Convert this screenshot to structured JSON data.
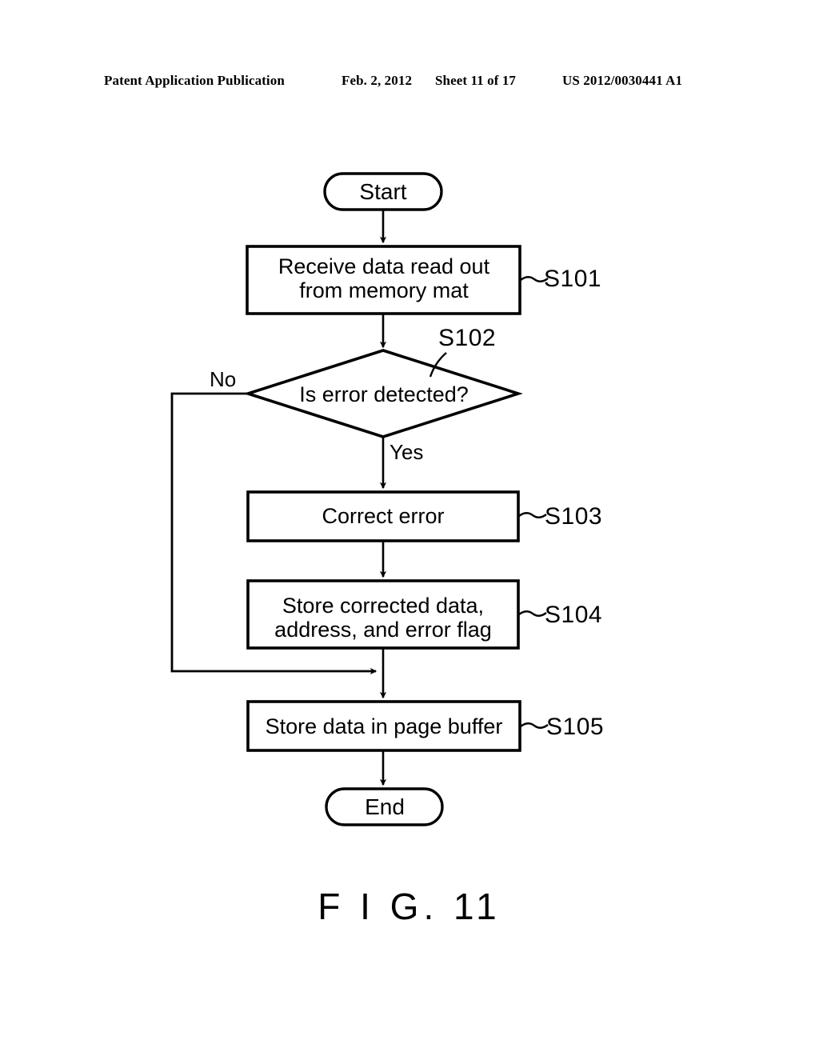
{
  "header": {
    "publication": "Patent Application Publication",
    "date": "Feb. 2, 2012",
    "sheet": "Sheet 11 of 17",
    "patent_number": "US 2012/0030441 A1"
  },
  "figure": {
    "caption": "F I G. 11",
    "nodes": {
      "start": "Start",
      "end": "End",
      "s101": "Receive data read out\nfrom memory mat",
      "s102": "Is error detected?",
      "s103": "Correct error",
      "s104": "Store corrected data,\naddress, and error flag",
      "s105": "Store data in page buffer"
    },
    "step_labels": {
      "s101": "S101",
      "s102": "S102",
      "s103": "S103",
      "s104": "S104",
      "s105": "S105"
    },
    "branch_labels": {
      "no": "No",
      "yes": "Yes"
    },
    "colors": {
      "ink": "#000000",
      "paper": "#ffffff"
    }
  }
}
